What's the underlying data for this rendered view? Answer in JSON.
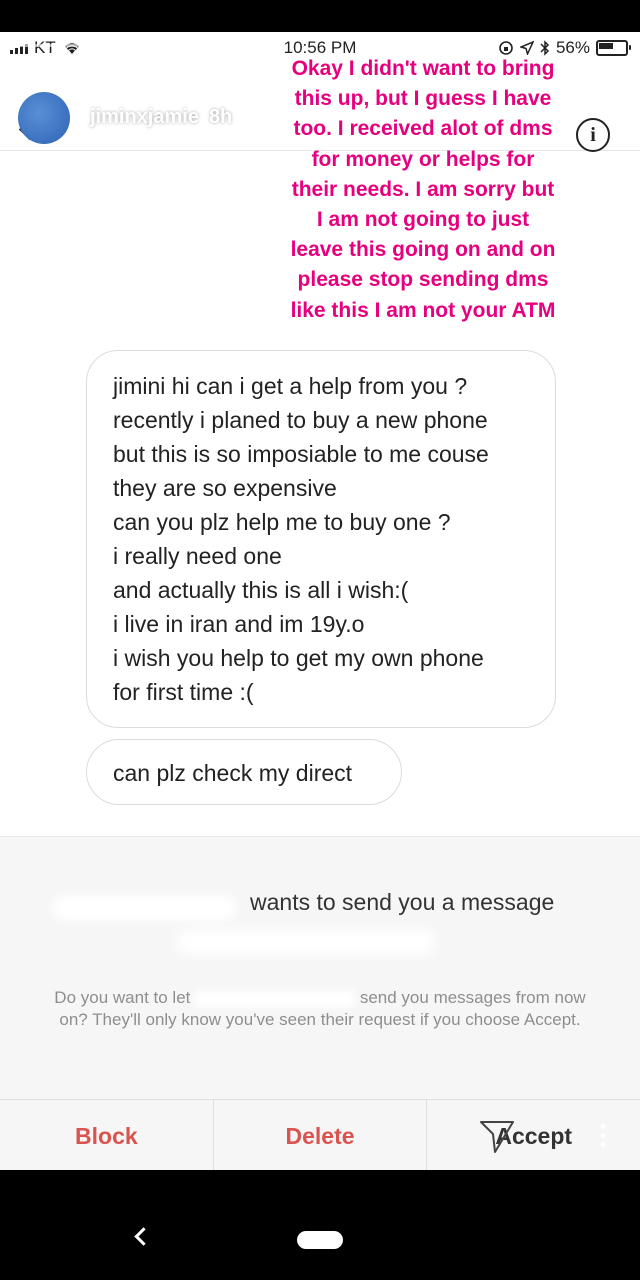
{
  "status_bar": {
    "carrier": "KT",
    "time": "10:56 PM",
    "battery": "56%"
  },
  "story": {
    "username": "jiminxjamie",
    "time_ago": "8h",
    "caption_lines": [
      "Okay I didn't want to bring",
      "this up, but I guess I have",
      "too. I received alot of dms",
      "for money or helps for",
      "their needs. I am sorry but",
      "I am not going to just",
      "leave this going on and on",
      "please stop sending dms",
      "like this I am not your ATM"
    ]
  },
  "messages": {
    "bubble1_lines": [
      "jimini hi can i get a help from you ?",
      "recently i planed to buy a new phone",
      "but this is so imposiable to me couse",
      "they are so expensive",
      "can you plz help me to buy one ?",
      "i really need one",
      "and actually this is all i wish:(",
      "i live in iran and im 19y.o",
      "i wish you help to get my own phone",
      "for first time :("
    ],
    "bubble2": "can plz check my direct"
  },
  "request": {
    "title_suffix": "wants to send you a message",
    "desc_part1": "Do you want to let",
    "desc_part2": "send you messages from now on? They'll only know you've seen their request if you choose Accept."
  },
  "actions": {
    "block": "Block",
    "delete": "Delete",
    "accept": "Accept"
  },
  "colors": {
    "caption": "#e6007e",
    "destructive": "#d9534f"
  }
}
